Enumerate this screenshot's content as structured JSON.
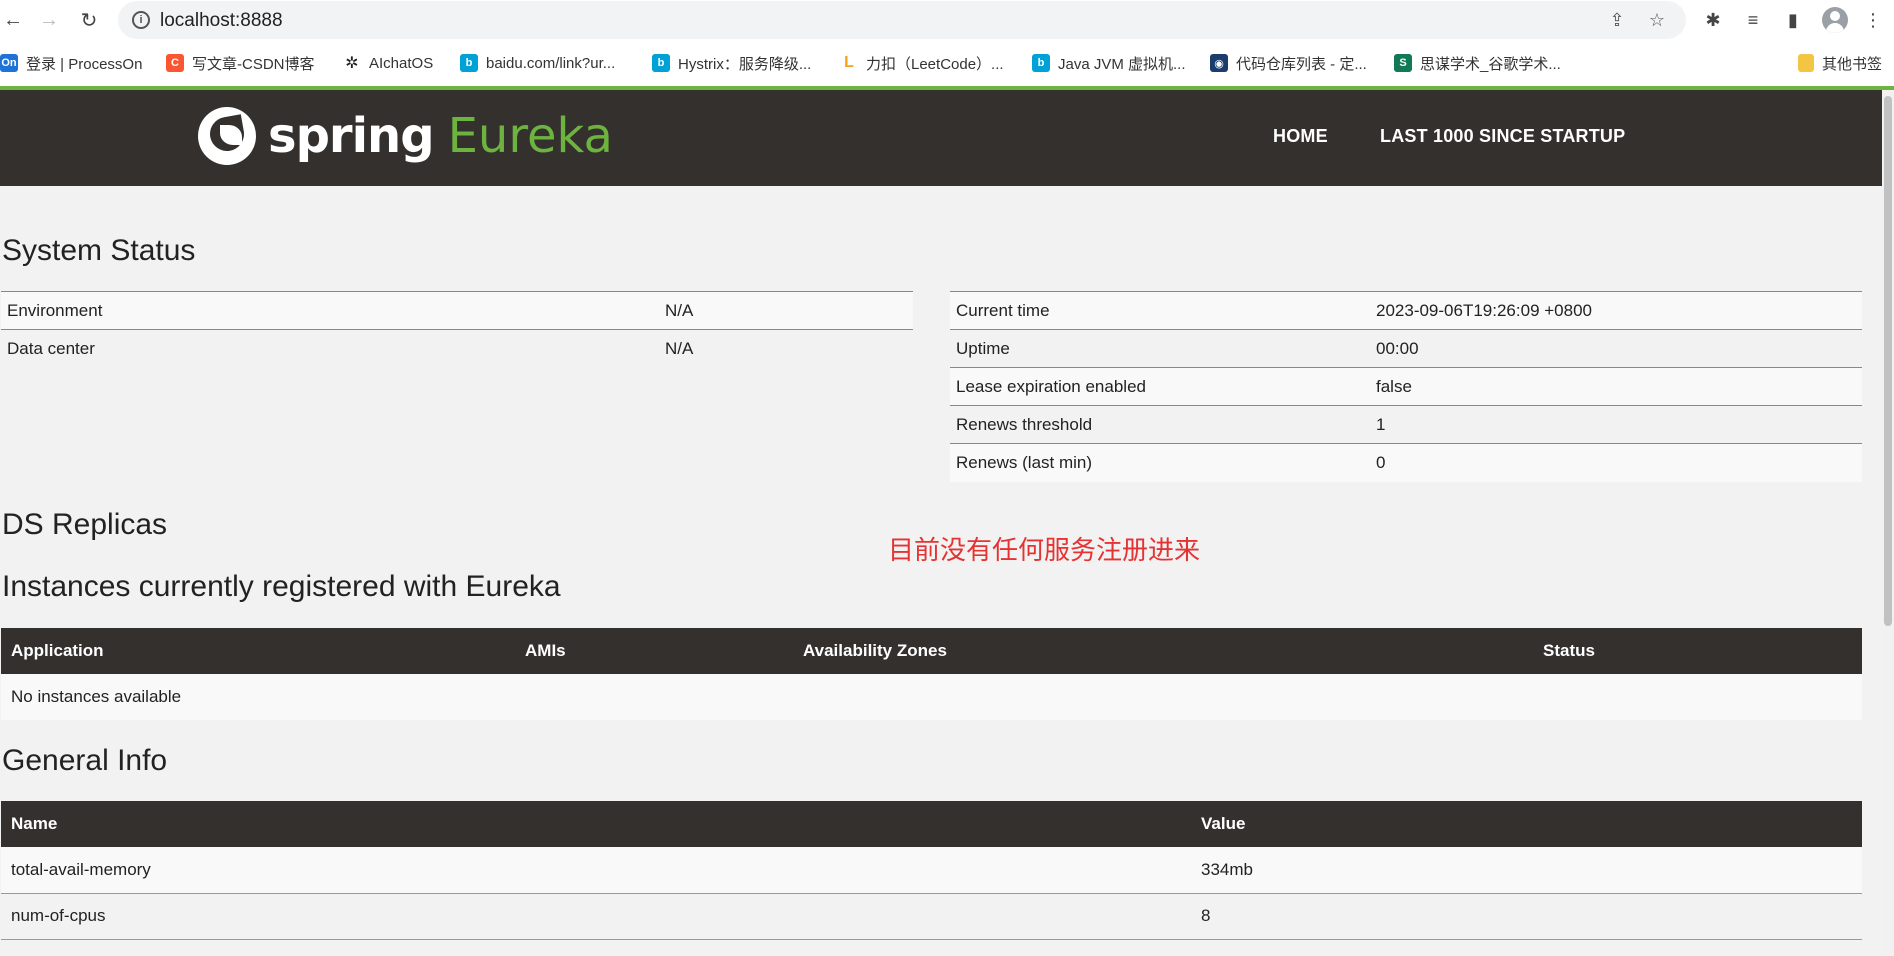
{
  "browser": {
    "url": "localhost:8888",
    "bookmarks": [
      {
        "label": "登录 | ProcessOn",
        "icon": "processon-icon",
        "badge": "On",
        "color": "#1e73d8"
      },
      {
        "label": "写文章-CSDN博客",
        "icon": "csdn-icon",
        "badge": "C",
        "color": "#fc5531"
      },
      {
        "label": "AIchatOS",
        "icon": "openai-icon",
        "badge": "✲",
        "color": "#222222"
      },
      {
        "label": "baidu.com/link?ur...",
        "icon": "bilibili-icon",
        "badge": "b",
        "color": "#00a1d6"
      },
      {
        "label": "Hystrix：服务降级...",
        "icon": "bilibili-icon",
        "badge": "b",
        "color": "#00a1d6"
      },
      {
        "label": "力扣（LeetCode）...",
        "icon": "leetcode-icon",
        "badge": "L",
        "color": "#f89f1b"
      },
      {
        "label": "Java JVM 虚拟机...",
        "icon": "bilibili-icon",
        "badge": "b",
        "color": "#00a1d6"
      },
      {
        "label": "代码仓库列表 - 定...",
        "icon": "repo-icon",
        "badge": "◉",
        "color": "#1a3d6d"
      },
      {
        "label": "思谋学术_谷歌学术...",
        "icon": "scholar-icon",
        "badge": "S",
        "color": "#0f7a55"
      },
      {
        "label": "其他书签",
        "icon": "folder-icon",
        "badge": "",
        "color": "#f4c542"
      }
    ]
  },
  "header": {
    "logo_spring": "spring",
    "logo_eureka": "Eureka",
    "nav_home": "HOME",
    "nav_last": "LAST 1000 SINCE STARTUP"
  },
  "system_status": {
    "title": "System Status",
    "left": [
      {
        "key": "Environment",
        "value": "N/A"
      },
      {
        "key": "Data center",
        "value": "N/A"
      }
    ],
    "right": [
      {
        "key": "Current time",
        "value": "2023-09-06T19:26:09 +0800"
      },
      {
        "key": "Uptime",
        "value": "00:00"
      },
      {
        "key": "Lease expiration enabled",
        "value": "false"
      },
      {
        "key": "Renews threshold",
        "value": "1"
      },
      {
        "key": "Renews (last min)",
        "value": "0"
      }
    ]
  },
  "ds_replicas": {
    "title": "DS Replicas"
  },
  "annotation": "目前没有任何服务注册进来",
  "instances": {
    "title": "Instances currently registered with Eureka",
    "headers": [
      "Application",
      "AMIs",
      "Availability Zones",
      "Status"
    ],
    "empty_text": "No instances available"
  },
  "general_info": {
    "title": "General Info",
    "headers": [
      "Name",
      "Value"
    ],
    "rows": [
      {
        "name": "total-avail-memory",
        "value": "334mb"
      },
      {
        "name": "num-of-cpus",
        "value": "8"
      }
    ]
  }
}
